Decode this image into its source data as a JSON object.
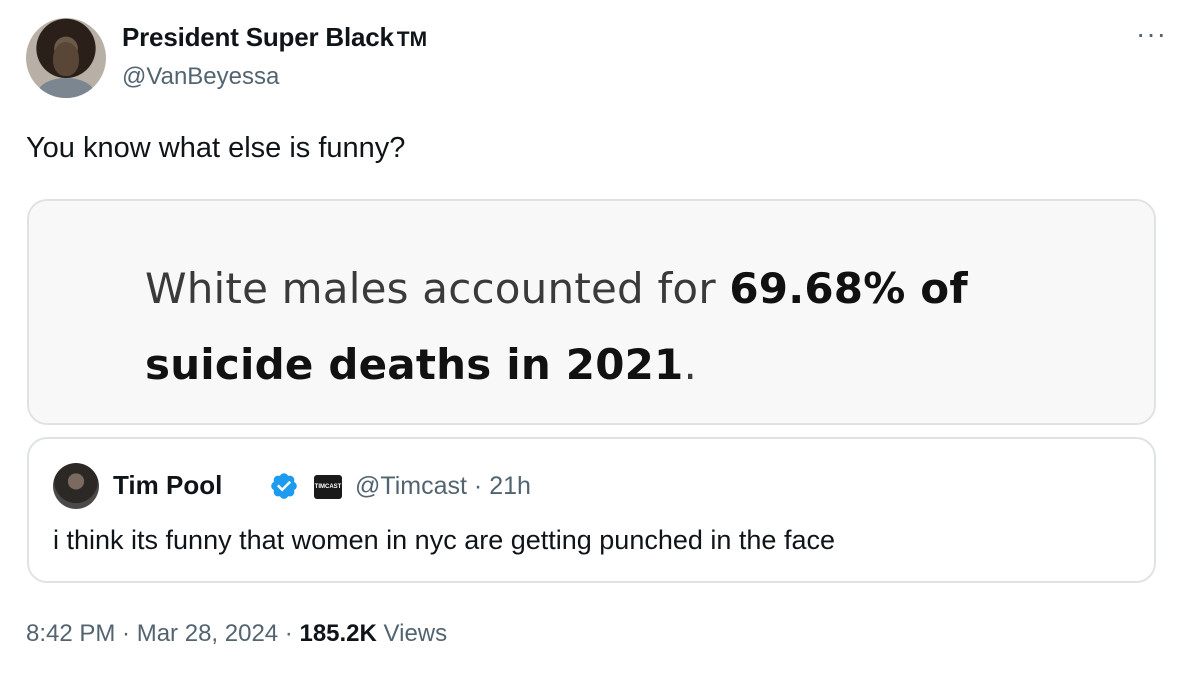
{
  "author": {
    "display_name": "President Super Black",
    "tm": "TM",
    "handle": "@VanBeyessa"
  },
  "more_label": "···",
  "tweet_text": "You know what else is funny?",
  "media_card": {
    "text_normal": "White males accounted for ",
    "text_bold_1": "69.68% of",
    "text_bold_2": "suicide deaths in 2021",
    "text_end": "."
  },
  "quoted_tweet": {
    "display_name": "Tim Pool",
    "affiliate_label": "TIMCAST",
    "handle": "@Timcast",
    "separator": "·",
    "time": "21h",
    "text": "i think its funny that women in nyc are getting punched in the face"
  },
  "footer": {
    "time": "8:42 PM",
    "date": "Mar 28, 2024",
    "views_count": "185.2K",
    "views_label": "Views"
  },
  "colors": {
    "verified_badge": "#1d9bf0",
    "secondary_text": "#536471",
    "border": "#dfe3e6"
  },
  "icons": {
    "verified": "verified-badge-icon",
    "more": "more-options-icon"
  }
}
